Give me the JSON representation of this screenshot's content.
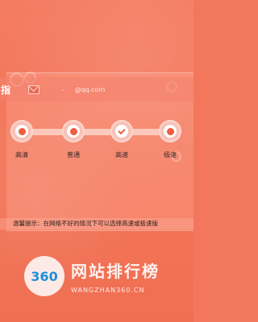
{
  "header": {
    "logo_label": "指",
    "email_prefix": "",
    "email_domain": "@qq.com",
    "dash": "-"
  },
  "speed": {
    "options": [
      {
        "label": "高清",
        "state": "dot"
      },
      {
        "label": "普通",
        "state": "dot"
      },
      {
        "label": "高速",
        "state": "check"
      },
      {
        "label": "极速",
        "state": "dot"
      }
    ]
  },
  "tip": {
    "text": "温馨提示：在网络不好的情况下可以选择高速或极速版"
  },
  "watermark": {
    "logo_text": "360",
    "title": "网站排行榜",
    "subtitle": "WANGZHAN360.CN"
  },
  "colors": {
    "accent": "#f25b3d",
    "background": "#f3775d"
  }
}
